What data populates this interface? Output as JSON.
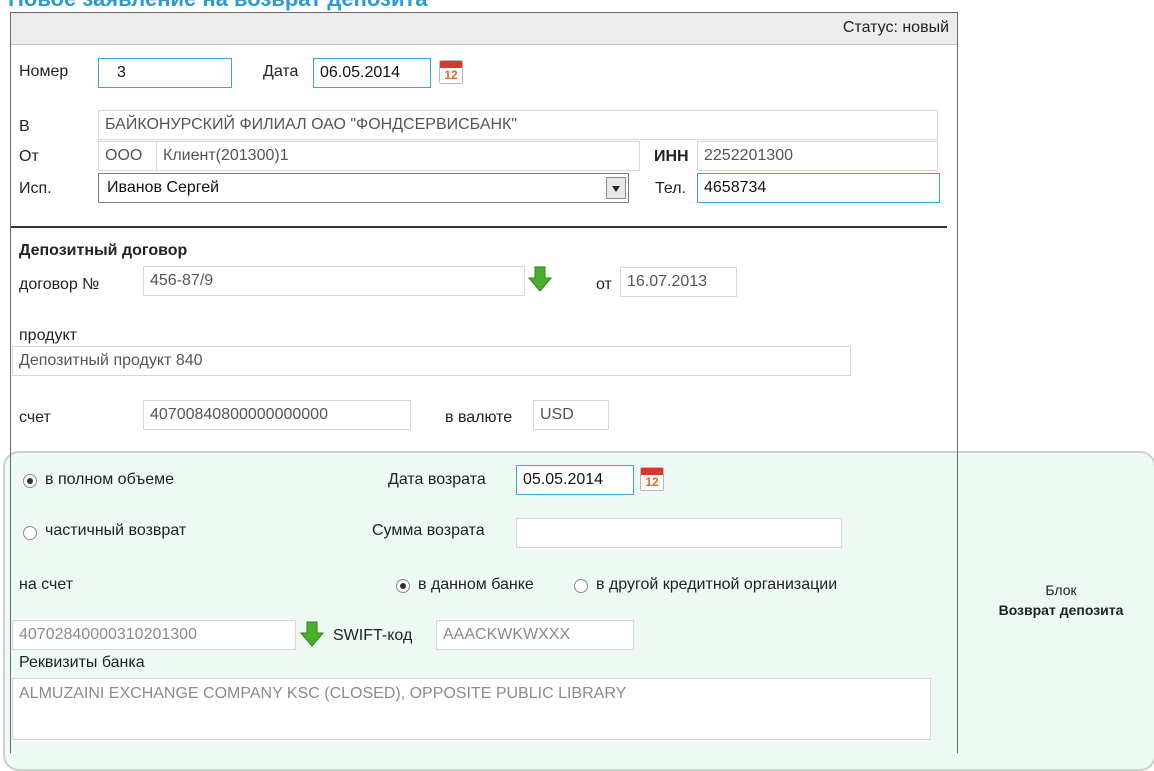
{
  "page_title": "Новое заявление на возврат депозита",
  "status": "Статус: новый",
  "header": {
    "number_label": "Номер",
    "number_value": "3",
    "date_label": "Дата",
    "date_value": "06.05.2014",
    "calendar_day": "12"
  },
  "parties": {
    "to_label": "В",
    "to_value": "БАЙКОНУРСКИЙ ФИЛИАЛ ОАО \"ФОНДСЕРВИСБАНК\"",
    "from_label": "От",
    "from_prefix": "ООО",
    "from_value": "Клиент(201300)1",
    "inn_label": "ИНН",
    "inn_value": "2252201300",
    "executor_label": "Исп.",
    "executor_value": "Иванов Сергей",
    "phone_label": "Тел.",
    "phone_value": "4658734"
  },
  "contract": {
    "section_title": "Депозитный договор",
    "number_label": "договор №",
    "number_value": "456-87/9",
    "from_label": "от",
    "from_value": "16.07.2013",
    "product_label": "продукт",
    "product_value": "Депозитный продукт 840",
    "account_label": "счет",
    "account_value": "40700840800000000000",
    "currency_label": "в валюте",
    "currency_value": "USD"
  },
  "refund": {
    "full_label": "в полном объеме",
    "full_selected": true,
    "partial_label": "частичный возврат",
    "partial_selected": false,
    "date_label": "Дата возрата",
    "date_value": "05.05.2014",
    "amount_label": "Сумма возрата",
    "amount_value": "",
    "to_account_label": "на счет",
    "this_bank_label": "в данном банке",
    "this_bank_selected": true,
    "other_bank_label": "в другой кредитной организации",
    "other_bank_selected": false,
    "account_value": "40702840000310201300",
    "swift_label": "SWIFT-код",
    "swift_value": "AAACKWKWXXX",
    "bank_details_label": "Реквизиты банка",
    "bank_details_value": "ALMUZAINI EXCHANGE COMPANY KSC (CLOSED), OPPOSITE PUBLIC LIBRARY"
  },
  "block_caption": {
    "line1": "Блок",
    "line2": "Возврат депозита"
  },
  "colors": {
    "accent": "#39a5d8",
    "title": "#2b9bd3",
    "block_bg": "#eef9f3",
    "arrow": "#4caf2c"
  },
  "icons": {
    "calendar": "calendar-icon",
    "arrow": "green-down-arrow-icon",
    "dropdown": "chevron-down-icon"
  }
}
